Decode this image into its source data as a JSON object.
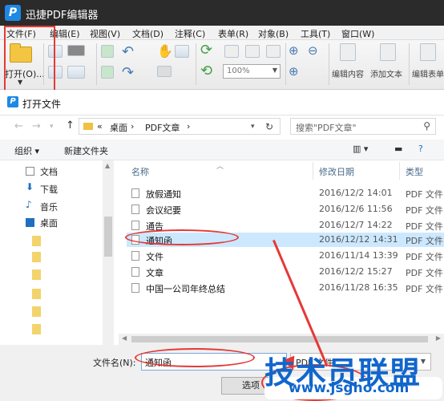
{
  "app": {
    "logo": "P",
    "title": "迅捷PDF编辑器"
  },
  "menu": [
    "文件(F)",
    "编辑(E)",
    "视图(V)",
    "文档(D)",
    "注释(C)",
    "表单(R)",
    "对象(B)",
    "工具(T)",
    "窗口(W)"
  ],
  "toolbar": {
    "open_label": "打开(O)...",
    "zoom_value": "100%",
    "edit_content": "编辑内容",
    "add_text": "添加文本",
    "edit_form": "编辑表单"
  },
  "dialog": {
    "title": "打开文件",
    "breadcrumb": [
      "«",
      "桌面",
      "›",
      "PDF文章",
      "›"
    ],
    "search_placeholder": "搜索\"PDF文章\"",
    "organize": "组织 ▾",
    "new_folder": "新建文件夹",
    "nav_items": [
      "文档",
      "下载",
      "音乐",
      "桌面"
    ],
    "columns": {
      "name": "名称",
      "date": "修改日期",
      "type": "类型"
    },
    "files": [
      {
        "name": "放假通知",
        "date": "2016/12/2 14:01",
        "type": "PDF 文件"
      },
      {
        "name": "会议纪要",
        "date": "2016/12/6 11:56",
        "type": "PDF 文件"
      },
      {
        "name": "通告",
        "date": "2016/12/7 14:22",
        "type": "PDF 文件"
      },
      {
        "name": "通知函",
        "date": "2016/12/12 14:31",
        "type": "PDF 文件",
        "selected": true
      },
      {
        "name": "文件",
        "date": "2016/11/14 13:39",
        "type": "PDF 文件"
      },
      {
        "name": "文章",
        "date": "2016/12/2 15:27",
        "type": "PDF 文件"
      },
      {
        "name": "中国一公司年终总结",
        "date": "2016/11/28 16:35",
        "type": "PDF 文件"
      }
    ],
    "filename_label": "文件名(N):",
    "filename_value": "通知函",
    "filetype_value": "PDF 文件",
    "options_button": "选项",
    "open_button": "打开",
    "cancel_button": "取消"
  },
  "watermark": {
    "text": "技术员联盟",
    "url": "www.jsgho.com"
  },
  "colors": {
    "highlight_red": "#e53935",
    "selection_blue": "#cce8ff",
    "watermark_blue": "#1166cc"
  }
}
